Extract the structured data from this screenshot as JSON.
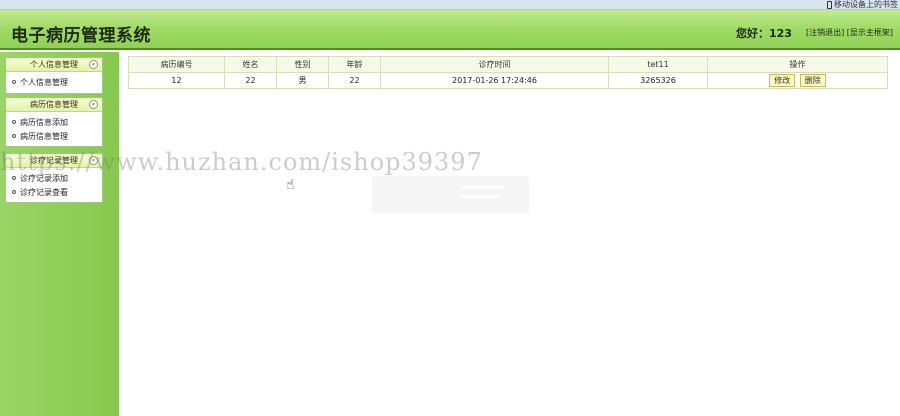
{
  "topbar": {
    "mobile_text": "移动设备上的书签"
  },
  "header": {
    "app_title": "电子病历管理系统",
    "greeting": "您好：123",
    "logout_link": "[注销退出]",
    "show_frame_link": "[显示主框架]"
  },
  "sidebar": {
    "groups": [
      {
        "title": "个人信息管理",
        "toggle": "«",
        "items": [
          "个人信息管理"
        ]
      },
      {
        "title": "病历信息管理",
        "toggle": "«",
        "items": [
          "病历信息添加",
          "病历信息管理"
        ]
      },
      {
        "title": "诊疗记录管理",
        "toggle": "«",
        "items": [
          "诊疗记录添加",
          "诊疗记录查看"
        ]
      }
    ]
  },
  "table": {
    "columns": [
      "病历编号",
      "姓名",
      "性别",
      "年龄",
      "诊疗时间",
      "tet11",
      "操作"
    ],
    "rows": [
      {
        "id": "12",
        "name": "22",
        "gender": "男",
        "age": "22",
        "time": "2017-01-26 17:24:46",
        "tet11": "3265326",
        "edit": "修改",
        "delete": "删除"
      }
    ]
  },
  "watermark": "https://www.huzhan.com/ishop39397",
  "colors": {
    "header_green": "#a2dc68",
    "sidebar_green": "#8fd155",
    "accent_dark": "#4c8f1d"
  }
}
